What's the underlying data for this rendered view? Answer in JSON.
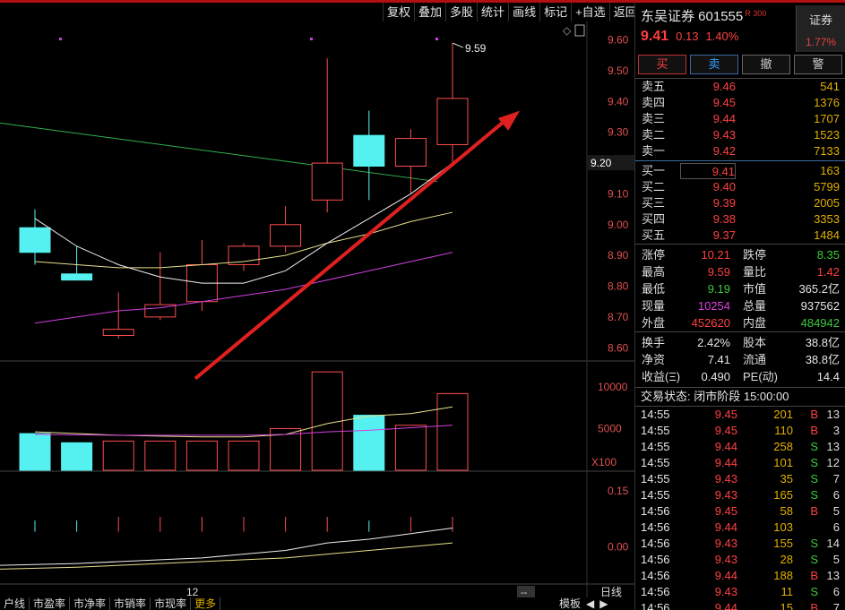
{
  "toolbar": [
    "复权",
    "叠加",
    "多股",
    "统计",
    "画线",
    "标记",
    "+自选",
    "返回"
  ],
  "stock": {
    "name_code": "东吴证券 601555",
    "badge": "R 300",
    "price": "9.41",
    "change": "0.13",
    "change_pct": "1.40%",
    "sector": "证券",
    "sector_pct": "1.77%"
  },
  "actions": [
    "买",
    "卖",
    "撤",
    "警"
  ],
  "asks": [
    {
      "label": "卖五",
      "price": "9.46",
      "vol": "541"
    },
    {
      "label": "卖四",
      "price": "9.45",
      "vol": "1376"
    },
    {
      "label": "卖三",
      "price": "9.44",
      "vol": "1707"
    },
    {
      "label": "卖二",
      "price": "9.43",
      "vol": "1523"
    },
    {
      "label": "卖一",
      "price": "9.42",
      "vol": "7133"
    }
  ],
  "bids": [
    {
      "label": "买一",
      "price": "9.41",
      "vol": "163"
    },
    {
      "label": "买二",
      "price": "9.40",
      "vol": "5799"
    },
    {
      "label": "买三",
      "price": "9.39",
      "vol": "2005"
    },
    {
      "label": "买四",
      "price": "9.38",
      "vol": "3353"
    },
    {
      "label": "买五",
      "price": "9.37",
      "vol": "1484"
    }
  ],
  "stats": [
    {
      "k": "涨停",
      "v": "10.21",
      "vc": "red",
      "k2": "跌停",
      "v2": "8.35",
      "v2c": "grn"
    },
    {
      "k": "最高",
      "v": "9.59",
      "vc": "red",
      "k2": "量比",
      "v2": "1.42",
      "v2c": "red"
    },
    {
      "k": "最低",
      "v": "9.19",
      "vc": "grn",
      "k2": "市值",
      "v2": "365.2亿",
      "v2c": "wht"
    },
    {
      "k": "现量",
      "v": "10254",
      "vc": "mag",
      "k2": "总量",
      "v2": "937562",
      "v2c": "wht"
    },
    {
      "k": "外盘",
      "v": "452620",
      "vc": "red",
      "k2": "内盘",
      "v2": "484942",
      "v2c": "grn"
    }
  ],
  "stats2": [
    {
      "k": "换手",
      "v": "2.42%",
      "vc": "wht",
      "k2": "股本",
      "v2": "38.8亿",
      "v2c": "wht"
    },
    {
      "k": "净资",
      "v": "7.41",
      "vc": "wht",
      "k2": "流通",
      "v2": "38.8亿",
      "v2c": "wht"
    },
    {
      "k": "收益(Ξ)",
      "v": "0.490",
      "vc": "wht",
      "k2": "PE(动)",
      "v2": "14.4",
      "v2c": "wht"
    }
  ],
  "status": "交易状态: 闭市阶段 15:00:00",
  "ticks": [
    {
      "t": "14:55",
      "p": "9.45",
      "v": "201",
      "s": "B",
      "n": "13"
    },
    {
      "t": "14:55",
      "p": "9.45",
      "v": "110",
      "s": "B",
      "n": "3"
    },
    {
      "t": "14:55",
      "p": "9.44",
      "v": "258",
      "s": "S",
      "n": "13"
    },
    {
      "t": "14:55",
      "p": "9.44",
      "v": "101",
      "s": "S",
      "n": "12"
    },
    {
      "t": "14:55",
      "p": "9.43",
      "v": "35",
      "s": "S",
      "n": "7"
    },
    {
      "t": "14:55",
      "p": "9.43",
      "v": "165",
      "s": "S",
      "n": "6"
    },
    {
      "t": "14:56",
      "p": "9.45",
      "v": "58",
      "s": "B",
      "n": "5"
    },
    {
      "t": "14:56",
      "p": "9.44",
      "v": "103",
      "s": "",
      "n": "6"
    },
    {
      "t": "14:56",
      "p": "9.43",
      "v": "155",
      "s": "S",
      "n": "14"
    },
    {
      "t": "14:56",
      "p": "9.43",
      "v": "28",
      "s": "S",
      "n": "5"
    },
    {
      "t": "14:56",
      "p": "9.44",
      "v": "188",
      "s": "B",
      "n": "13"
    },
    {
      "t": "14:56",
      "p": "9.43",
      "v": "11",
      "s": "S",
      "n": "6"
    },
    {
      "t": "14:56",
      "p": "9.44",
      "v": "15",
      "s": "B",
      "n": "7"
    }
  ],
  "bottom_tabs": [
    "户线",
    "市盈率",
    "市净率",
    "市销率",
    "市现率",
    "更多"
  ],
  "bottom_right": [
    "模板",
    "◀",
    "▶"
  ],
  "chart": {
    "price_ticks": [
      "9.60",
      "9.50",
      "9.40",
      "9.30",
      "9.20",
      "9.10",
      "9.00",
      "8.90",
      "8.80",
      "8.70",
      "8.60"
    ],
    "current_price_label": "9.20",
    "high_label": "9.59",
    "vol_ticks": [
      "10000",
      "5000"
    ],
    "vol_unit": "X100",
    "ind_ticks": [
      "0.15",
      "0.00"
    ],
    "x_label": "12",
    "period": "日线",
    "zoom_label": "--"
  },
  "chart_data": {
    "type": "candlestick",
    "candles": [
      {
        "o": 8.99,
        "h": 9.05,
        "l": 8.87,
        "c": 8.91,
        "up": false
      },
      {
        "o": 8.84,
        "h": 8.93,
        "l": 8.82,
        "c": 8.82,
        "up": false
      },
      {
        "o": 8.64,
        "h": 8.78,
        "l": 8.63,
        "c": 8.66,
        "up": true
      },
      {
        "o": 8.7,
        "h": 8.91,
        "l": 8.69,
        "c": 8.74,
        "up": true
      },
      {
        "o": 8.75,
        "h": 8.95,
        "l": 8.72,
        "c": 8.87,
        "up": true
      },
      {
        "o": 8.87,
        "h": 8.94,
        "l": 8.85,
        "c": 8.93,
        "up": true
      },
      {
        "o": 8.93,
        "h": 9.06,
        "l": 8.91,
        "c": 9.0,
        "up": true
      },
      {
        "o": 9.08,
        "h": 9.54,
        "l": 9.04,
        "c": 9.2,
        "up": true
      },
      {
        "o": 9.29,
        "h": 9.37,
        "l": 9.08,
        "c": 9.19,
        "up": false
      },
      {
        "o": 9.19,
        "h": 9.31,
        "l": 9.1,
        "c": 9.28,
        "up": true
      },
      {
        "o": 9.26,
        "h": 9.59,
        "l": 9.19,
        "c": 9.41,
        "up": true
      }
    ],
    "volumes": [
      4400,
      3300,
      3500,
      3500,
      3500,
      3500,
      5000,
      11800,
      6600,
      5400,
      9200
    ],
    "ma_white": [
      9.02,
      8.93,
      8.87,
      8.83,
      8.81,
      8.81,
      8.85,
      8.94,
      9.02,
      9.1,
      9.2
    ],
    "ma_yellow": [
      8.88,
      8.87,
      8.86,
      8.86,
      8.87,
      8.88,
      8.9,
      8.94,
      8.97,
      9.01,
      9.04
    ],
    "ma_purple": [
      8.68,
      8.7,
      8.72,
      8.73,
      8.75,
      8.77,
      8.79,
      8.82,
      8.85,
      8.88,
      8.91
    ],
    "ma_green_start": 9.33,
    "ma_green_end": 9.14,
    "arrow": {
      "from": [
        8.5,
        3.5
      ],
      "to": [
        9.37,
        11.8
      ]
    },
    "colors": {
      "up": "#ff4d4d",
      "down": "#55f0f0",
      "white": "#eeeeee",
      "yellow": "#e6e08a",
      "purple": "#d040e0",
      "green": "#30b050",
      "arrow": "#e02020"
    }
  }
}
